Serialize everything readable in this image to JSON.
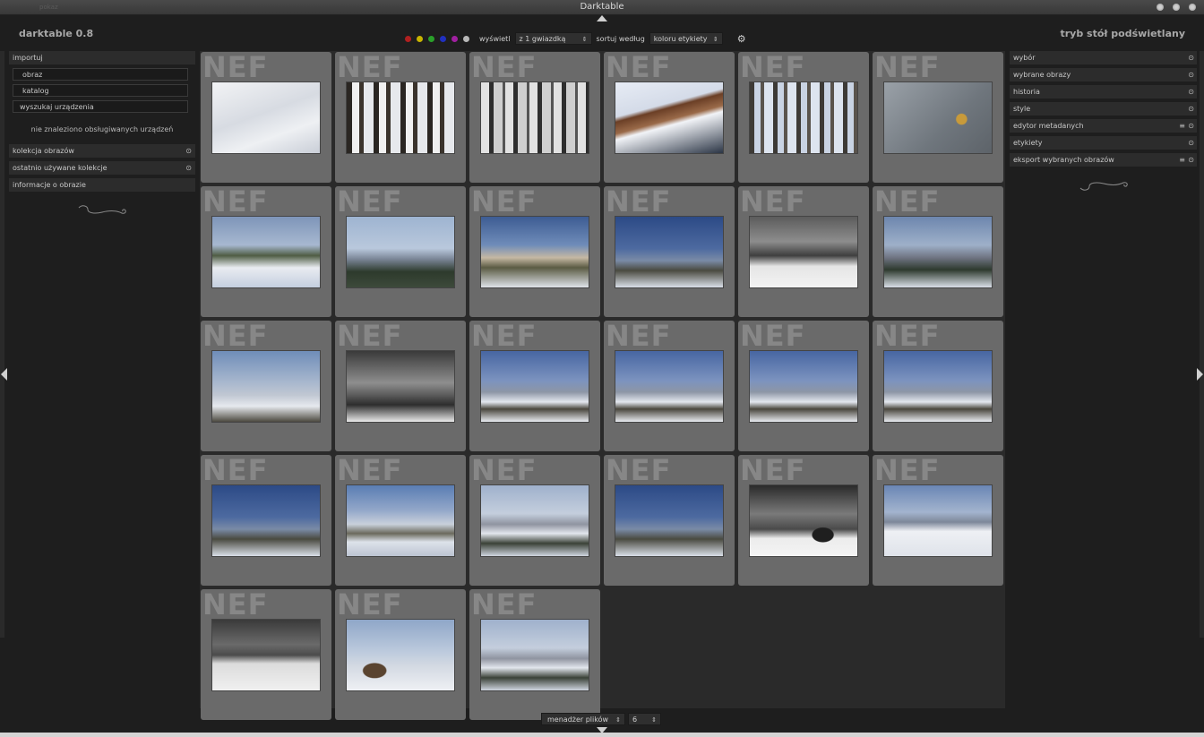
{
  "window": {
    "title": "Darktable",
    "ghost_text": "pokaz"
  },
  "header": {
    "app_name": "darktable 0.8",
    "view_name": "tryb stół podświetlany"
  },
  "filterbar": {
    "color_labels": [
      "#b02020",
      "#c8b400",
      "#2aa02a",
      "#2030c0",
      "#a020a0",
      "#b8b8b8"
    ],
    "show_label": "wyświetl",
    "show_value": "z 1 gwiazdką",
    "sort_label": "sortuj według",
    "sort_value": "koloru etykiety",
    "settings_icon": "gear-icon"
  },
  "left": {
    "import_header": "importuj",
    "buttons": [
      "obraz",
      "katalog",
      "wyszukaj urządzenia"
    ],
    "no_devices": "nie znaleziono obsługiwanych urządzeń",
    "collection_header": "kolekcja obrazów",
    "recent_header": "ostatnio używane kolekcje",
    "info_header": "informacje o obrazie"
  },
  "right": {
    "modules": [
      {
        "label": "wybór",
        "icon": "reset-icon"
      },
      {
        "label": "wybrane obrazy",
        "icon": "reset-icon"
      },
      {
        "label": "historia",
        "icon": "reset-icon"
      },
      {
        "label": "style",
        "icon": "reset-icon"
      },
      {
        "label": "edytor metadanych",
        "icon": "reset-icon",
        "menu": true
      },
      {
        "label": "etykiety",
        "icon": "reset-icon"
      },
      {
        "label": "eksport wybranych obrazów",
        "icon": "reset-icon",
        "menu": true
      }
    ]
  },
  "grid": {
    "ext_label": "NEF",
    "columns": 6,
    "thumbnails": [
      {
        "id": 1,
        "scene": "snow"
      },
      {
        "id": 2,
        "scene": "forest"
      },
      {
        "id": 3,
        "scene": "forest-bw"
      },
      {
        "id": 4,
        "scene": "log"
      },
      {
        "id": 5,
        "scene": "woods"
      },
      {
        "id": 6,
        "scene": "leaf"
      },
      {
        "id": 7,
        "scene": "valley-sky"
      },
      {
        "id": 8,
        "scene": "hills-pale"
      },
      {
        "id": 9,
        "scene": "sunset-hill"
      },
      {
        "id": 10,
        "scene": "blue-hills"
      },
      {
        "id": 11,
        "scene": "grey-field"
      },
      {
        "id": 12,
        "scene": "trees-hill"
      },
      {
        "id": 13,
        "scene": "tree"
      },
      {
        "id": 14,
        "scene": "grey-hills"
      },
      {
        "id": 15,
        "scene": "snow-hills"
      },
      {
        "id": 16,
        "scene": "snow-hills"
      },
      {
        "id": 17,
        "scene": "snow-hills"
      },
      {
        "id": 18,
        "scene": "snow-hills"
      },
      {
        "id": 19,
        "scene": "blue-hills"
      },
      {
        "id": 20,
        "scene": "snow-valley"
      },
      {
        "id": 21,
        "scene": "pale-valley"
      },
      {
        "id": 22,
        "scene": "blue-hills"
      },
      {
        "id": 23,
        "scene": "teepee"
      },
      {
        "id": 24,
        "scene": "snow-field"
      },
      {
        "id": 25,
        "scene": "grey-slope"
      },
      {
        "id": 26,
        "scene": "bush"
      },
      {
        "id": 27,
        "scene": "pale-valley"
      }
    ]
  },
  "bottom": {
    "mode_value": "menadżer plików",
    "zoom_value": "6"
  }
}
